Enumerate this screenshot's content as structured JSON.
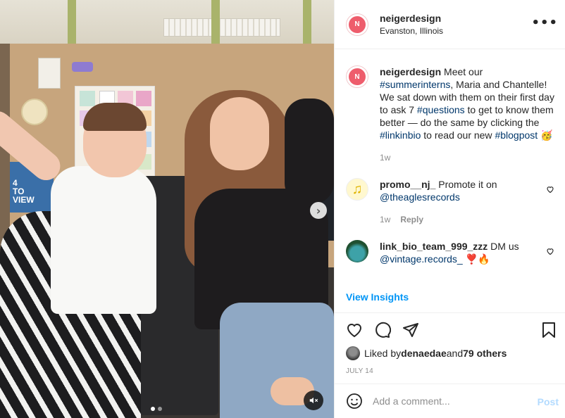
{
  "post": {
    "username": "neigerdesign",
    "location": "Evanston, Illinois",
    "avatar_letter": "N",
    "caption_user": "neigerdesign",
    "caption_parts": [
      {
        "t": " Meet our ",
        "tag": false
      },
      {
        "t": "#summerinterns",
        "tag": true
      },
      {
        "t": ", Maria and Chantelle! We sat down with them on their first day to ask 7 ",
        "tag": false
      },
      {
        "t": "#questions",
        "tag": true
      },
      {
        "t": " to get to know them better — do the same by clicking the ",
        "tag": false
      },
      {
        "t": "#linkinbio",
        "tag": true
      },
      {
        "t": " to read our new ",
        "tag": false
      },
      {
        "t": "#blogpost",
        "tag": true
      },
      {
        "t": " 🥳",
        "tag": false
      }
    ],
    "caption_time": "1w"
  },
  "comments": [
    {
      "user": "promo__nj_",
      "text": " Promote it on ",
      "mention": "@theaglesrecords",
      "time": "1w",
      "reply": "Reply",
      "avatar_icon": "music-note-icon"
    },
    {
      "user": "link_bio_team_999_zzz",
      "text": " DM us ",
      "mention": "@vintage.records_",
      "emoji": " ❣️🔥",
      "avatar_icon": "avatar"
    }
  ],
  "insights_label": "View Insights",
  "likes": {
    "prefix": "Liked by ",
    "user": "denaedae",
    "middle": " and ",
    "others": "79 others"
  },
  "date": "JULY 14",
  "add_comment": {
    "placeholder": "Add a comment...",
    "post_label": "Post"
  },
  "menu_icon": "more-icon",
  "colors": {
    "link": "#00376b",
    "blue": "#0095f6",
    "post_disabled": "#b3dbff",
    "brand": "#ee5d6c"
  }
}
